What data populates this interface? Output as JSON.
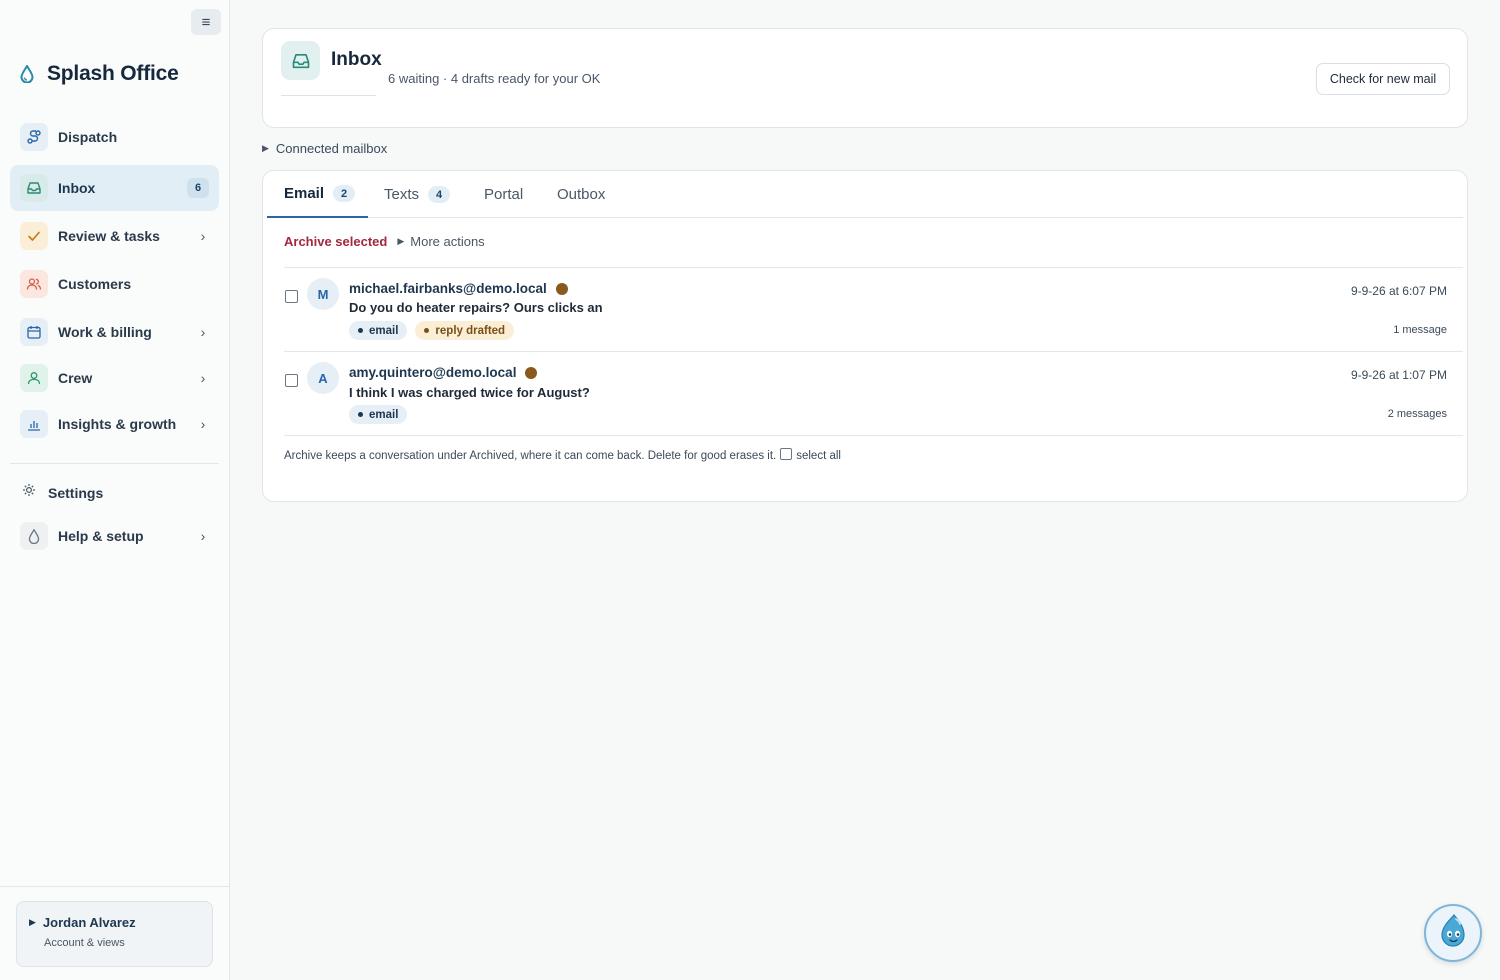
{
  "sidebar": {
    "collapse_icon": "menu-icon",
    "brand": {
      "name": "Splash Office",
      "icon": "water-drop-icon"
    },
    "items": [
      {
        "label": "Dispatch",
        "icon": "route-icon",
        "has_chevron": false
      },
      {
        "label": "Inbox",
        "icon": "inbox-icon",
        "badge": "6",
        "active": true
      },
      {
        "label": "Review & tasks",
        "icon": "check-icon",
        "has_chevron": true
      },
      {
        "label": "Customers",
        "icon": "users-icon",
        "has_chevron": false
      },
      {
        "label": "Work & billing",
        "icon": "calendar-icon",
        "has_chevron": true
      },
      {
        "label": "Crew",
        "icon": "person-icon",
        "has_chevron": true
      },
      {
        "label": "Insights & growth",
        "icon": "bar-chart-icon",
        "has_chevron": true
      }
    ],
    "settings": {
      "label": "Settings",
      "icon": "gear-icon"
    },
    "help": {
      "label": "Help & setup",
      "icon": "water-drop-icon",
      "has_chevron": true
    },
    "user": {
      "name": "Jordan Alvarez",
      "subtitle": "Account & views"
    }
  },
  "header": {
    "title": "Inbox",
    "subtitle": "6 waiting · 4 drafts ready for your OK",
    "check_button": "Check for new mail"
  },
  "connected_mailbox": "Connected mailbox",
  "tabs": [
    {
      "label": "Email",
      "count": "2",
      "active": true
    },
    {
      "label": "Texts",
      "count": "4"
    },
    {
      "label": "Portal"
    },
    {
      "label": "Outbox"
    }
  ],
  "actions": {
    "archive_selected": "Archive selected",
    "more_actions": "More actions"
  },
  "messages": [
    {
      "avatar": "M",
      "sender": "michael.fairbanks@demo.local",
      "subject": "Do you do heater repairs? Ours clicks an",
      "chips": [
        "email",
        "reply drafted"
      ],
      "date": "9-9-26 at 6:07 PM",
      "count": "1 message",
      "unread": true
    },
    {
      "avatar": "A",
      "sender": "amy.quintero@demo.local",
      "subject": "I think I was charged twice for August?",
      "chips": [
        "email"
      ],
      "date": "9-9-26 at 1:07 PM",
      "count": "2 messages",
      "unread": true
    }
  ],
  "footer": {
    "note": "Archive keeps a conversation under Archived, where it can come back. Delete for good erases it.",
    "select_all": "select all"
  },
  "colors": {
    "accent": "#2767a8",
    "danger": "#a3283f",
    "unread_dot": "#8a5a1c",
    "active_nav_bg": "#e2eef6"
  },
  "assistant_icon": "assistant-drop-icon"
}
